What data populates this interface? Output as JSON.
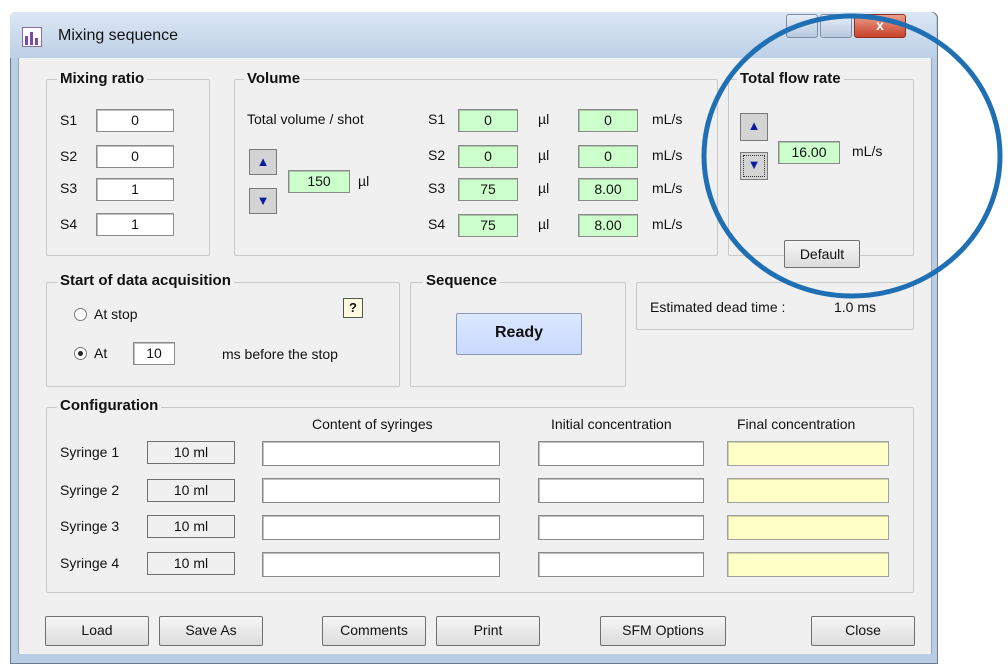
{
  "window": {
    "title": "Mixing sequence",
    "close_glyph": "x"
  },
  "mixing_ratio": {
    "title": "Mixing ratio",
    "rows": [
      {
        "label": "S1",
        "value": "0"
      },
      {
        "label": "S2",
        "value": "0"
      },
      {
        "label": "S3",
        "value": "1"
      },
      {
        "label": "S4",
        "value": "1"
      }
    ]
  },
  "volume": {
    "title": "Volume",
    "total_label": "Total volume / shot",
    "total_value": "150",
    "total_unit": "µl",
    "rows": [
      {
        "label": "S1",
        "vol": "0",
        "vol_unit": "µl",
        "flow": "0",
        "flow_unit": "mL/s"
      },
      {
        "label": "S2",
        "vol": "0",
        "vol_unit": "µl",
        "flow": "0",
        "flow_unit": "mL/s"
      },
      {
        "label": "S3",
        "vol": "75",
        "vol_unit": "µl",
        "flow": "8.00",
        "flow_unit": "mL/s"
      },
      {
        "label": "S4",
        "vol": "75",
        "vol_unit": "µl",
        "flow": "8.00",
        "flow_unit": "mL/s"
      }
    ]
  },
  "flow_rate": {
    "title": "Total flow rate",
    "value": "16.00",
    "unit": "mL/s",
    "default_label": "Default"
  },
  "acquisition": {
    "title": "Start of data acquisition",
    "option_stop": "At stop",
    "option_at": "At",
    "at_value": "10",
    "suffix": "ms before the stop",
    "help_glyph": "?",
    "selected": "at"
  },
  "sequence": {
    "title": "Sequence",
    "button": "Ready"
  },
  "dead_time": {
    "label": "Estimated dead time :",
    "value": "1.0 ms"
  },
  "configuration": {
    "title": "Configuration",
    "headers": {
      "content": "Content of syringes",
      "initial": "Initial concentration",
      "final": "Final concentration"
    },
    "syringes": [
      {
        "label": "Syringe 1",
        "size": "10 ml"
      },
      {
        "label": "Syringe 2",
        "size": "10 ml"
      },
      {
        "label": "Syringe 3",
        "size": "10 ml"
      },
      {
        "label": "Syringe 4",
        "size": "10 ml"
      }
    ]
  },
  "buttons": {
    "load": "Load",
    "save_as": "Save As",
    "comments": "Comments",
    "print": "Print",
    "sfm_options": "SFM Options",
    "close": "Close"
  },
  "annotation": {
    "color": "#1f6fb5",
    "shape": "circle"
  }
}
